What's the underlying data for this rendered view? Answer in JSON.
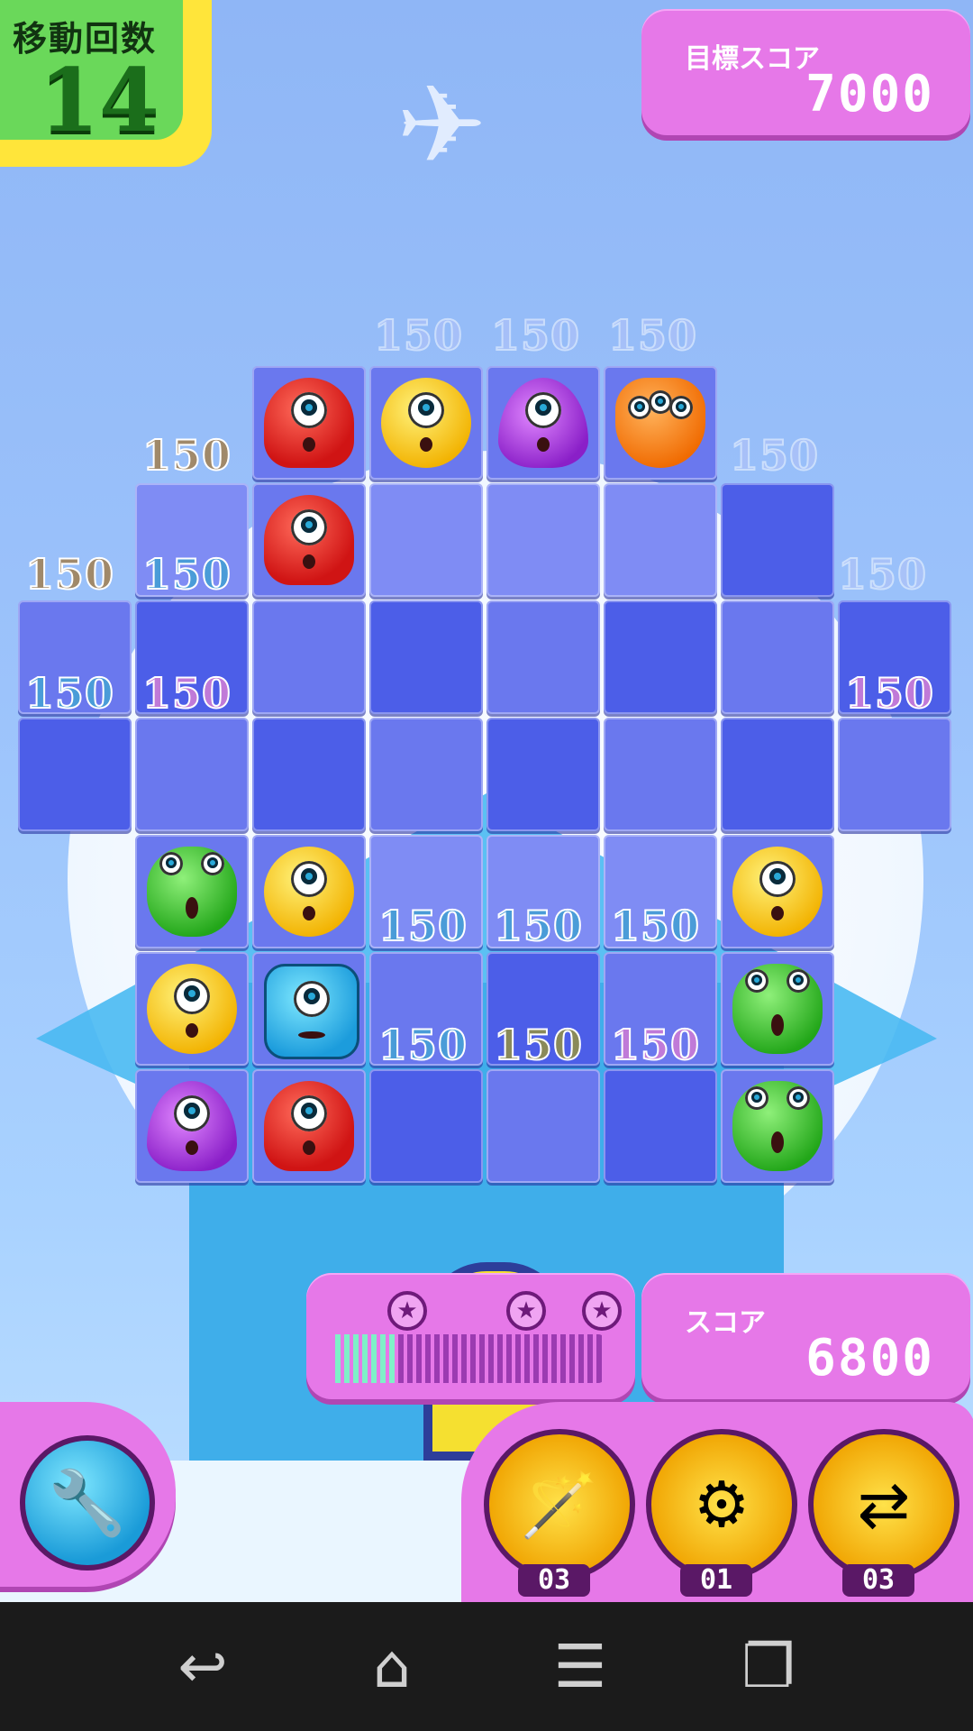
{
  "moves": {
    "label": "移動回数",
    "value": "14"
  },
  "target": {
    "label": "目標スコア",
    "value": "7000"
  },
  "score": {
    "label": "スコア",
    "value": "6800"
  },
  "progress": {
    "fill_fraction": 0.22,
    "stars": 3
  },
  "powerups": [
    {
      "icon": "wand-icon",
      "count": "03"
    },
    {
      "icon": "saw-icon",
      "count": "01"
    },
    {
      "icon": "swap-icon",
      "count": "03"
    }
  ],
  "points_popups": [
    "150",
    "150",
    "150",
    "150",
    "150",
    "150",
    "150",
    "150",
    "150",
    "150",
    "150",
    "150",
    "150",
    "150",
    "150",
    "150",
    "150",
    "150"
  ],
  "colors": {
    "panel_pink": "#e678e8",
    "moves_green": "#6ad85a",
    "moves_border": "#ffe53a",
    "board_tile": "#6a78ee"
  },
  "navbar": {
    "back": "back-icon",
    "home": "home-icon",
    "menu": "menu-icon",
    "recents": "recents-icon"
  }
}
